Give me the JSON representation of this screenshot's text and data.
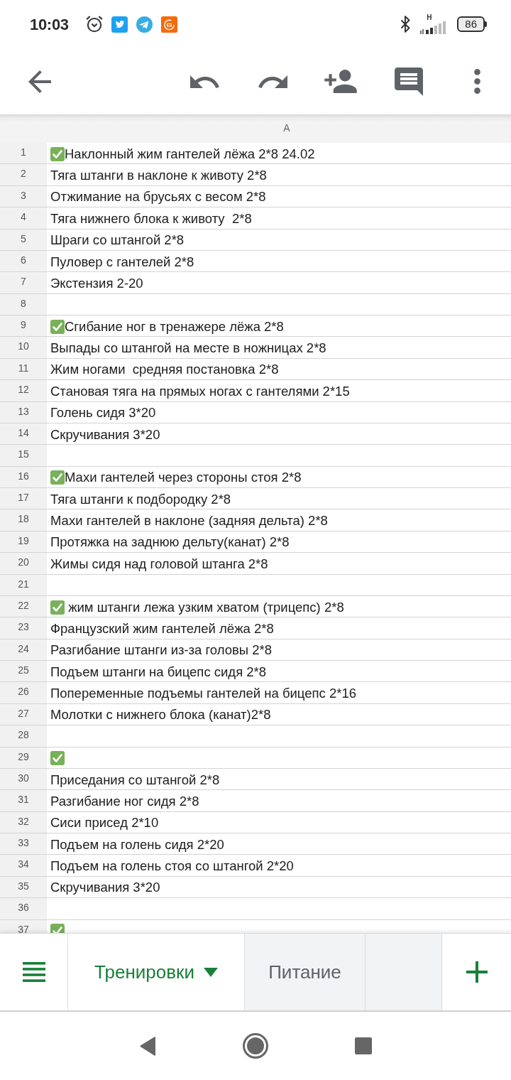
{
  "status_bar": {
    "time": "10:03",
    "network_type": "H",
    "battery": "86"
  },
  "sheet": {
    "columns": [
      "A"
    ],
    "rows": [
      {
        "number": "1",
        "done": true,
        "text": "Наклонный жим гантелей лёжа 2*8 24.02"
      },
      {
        "number": "2",
        "done": false,
        "text": "Тяга штанги в наклоне к животу 2*8"
      },
      {
        "number": "3",
        "done": false,
        "text": "Отжимание на брусьях с весом 2*8"
      },
      {
        "number": "4",
        "done": false,
        "text": "Тяга нижнего блока к животу  2*8"
      },
      {
        "number": "5",
        "done": false,
        "text": "Шраги со штангой 2*8"
      },
      {
        "number": "6",
        "done": false,
        "text": "Пуловер с гантелей 2*8"
      },
      {
        "number": "7",
        "done": false,
        "text": "Экстензия 2-20"
      },
      {
        "number": "8",
        "done": false
      },
      {
        "number": "9",
        "done": true,
        "text": "Сгибание ног в тренажере лёжа 2*8"
      },
      {
        "number": "10",
        "done": false,
        "text": "Выпады со штангой на месте в ножницах 2*8"
      },
      {
        "number": "11",
        "done": false,
        "text": "Жим ногами  средняя постановка 2*8"
      },
      {
        "number": "12",
        "done": false,
        "text": "Становая тяга на прямых ногах с гантелями 2*15"
      },
      {
        "number": "13",
        "done": false,
        "text": "Голень сидя 3*20"
      },
      {
        "number": "14",
        "done": false,
        "text": "Скручивания 3*20"
      },
      {
        "number": "15",
        "done": false
      },
      {
        "number": "16",
        "done": true,
        "text": "Махи гантелей через стороны стоя 2*8"
      },
      {
        "number": "17",
        "done": false,
        "text": "Тяга штанги к подбородку 2*8"
      },
      {
        "number": "18",
        "done": false,
        "text": "Махи гантелей в наклоне (задняя дельта) 2*8"
      },
      {
        "number": "19",
        "done": false,
        "text": "Протяжка на заднюю дельту(канат) 2*8"
      },
      {
        "number": "20",
        "done": false,
        "text": "Жимы сидя над головой штанга 2*8"
      },
      {
        "number": "21",
        "done": false
      },
      {
        "number": "22",
        "done": true,
        "text": " жим штанги лежа узким хватом (трицепс) 2*8"
      },
      {
        "number": "23",
        "done": false,
        "text": "Французский жим гантелей лёжа 2*8"
      },
      {
        "number": "24",
        "done": false,
        "text": "Разгибание штанги из-за головы 2*8"
      },
      {
        "number": "25",
        "done": false,
        "text": "Подъем штанги на бицепс сидя 2*8"
      },
      {
        "number": "26",
        "done": false,
        "text": "Попеременные подъемы гантелей на бицепс 2*16"
      },
      {
        "number": "27",
        "done": false,
        "text": "Молотки с нижнего блока (канат)2*8"
      },
      {
        "number": "28",
        "done": false
      },
      {
        "number": "29",
        "done": true
      },
      {
        "number": "30",
        "done": false,
        "text": "Приседания со штангой 2*8"
      },
      {
        "number": "31",
        "done": false,
        "text": "Разгибание ног сидя 2*8"
      },
      {
        "number": "32",
        "done": false,
        "text": "Сиси присед 2*10"
      },
      {
        "number": "33",
        "done": false,
        "text": "Подъем на голень сидя 2*20"
      },
      {
        "number": "34",
        "done": false,
        "text": "Подъем на голень стоя со штангой 2*20"
      },
      {
        "number": "35",
        "done": false,
        "text": "Скручивания 3*20"
      },
      {
        "number": "36",
        "done": false
      },
      {
        "number": "37",
        "done": true
      }
    ]
  },
  "sheet_tabs": [
    {
      "label": "Тренировки",
      "selected": true
    },
    {
      "label": "Питание",
      "selected": false
    }
  ]
}
